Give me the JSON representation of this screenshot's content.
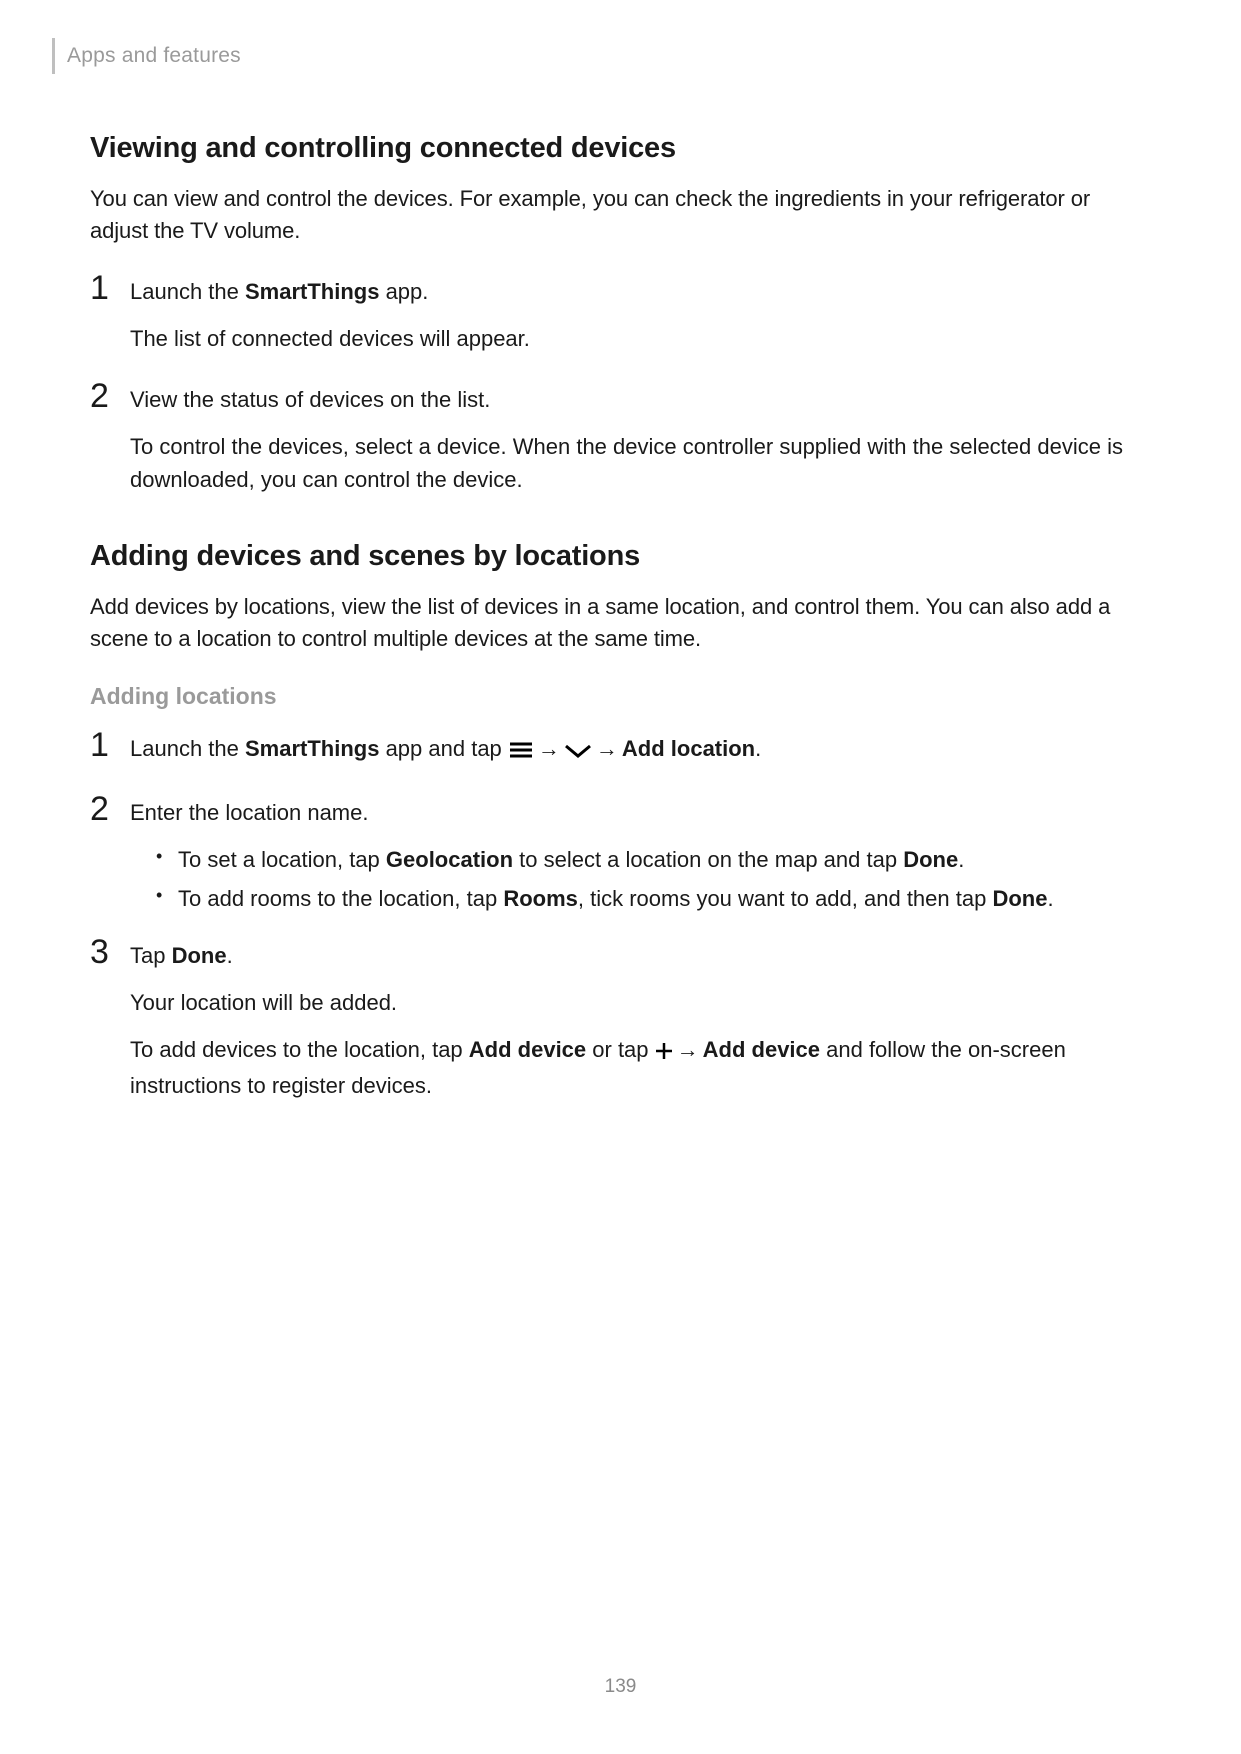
{
  "header": {
    "breadcrumb": "Apps and features"
  },
  "section1": {
    "title": "Viewing and controlling connected devices",
    "intro": "You can view and control the devices. For example, you can check the ingredients in your refrigerator or adjust the TV volume.",
    "steps": [
      {
        "num": "1",
        "line1_pre": "Launch the ",
        "line1_bold": "SmartThings",
        "line1_post": " app.",
        "line2": "The list of connected devices will appear."
      },
      {
        "num": "2",
        "line1": "View the status of devices on the list.",
        "line2": "To control the devices, select a device. When the device controller supplied with the selected device is downloaded, you can control the device."
      }
    ]
  },
  "section2": {
    "title": "Adding devices and scenes by locations",
    "intro": "Add devices by locations, view the list of devices in a same location, and control them. You can also add a scene to a location to control multiple devices at the same time.",
    "subheading": "Adding locations",
    "steps": [
      {
        "num": "1",
        "pre": "Launch the ",
        "bold1": "SmartThings",
        "mid": " app and tap ",
        "arrow1": " → ",
        "arrow2": " → ",
        "bold2": "Add location",
        "post": "."
      },
      {
        "num": "2",
        "line1": "Enter the location name.",
        "bullets": [
          {
            "pre": "To set a location, tap ",
            "b1": "Geolocation",
            "mid": " to select a location on the map and tap ",
            "b2": "Done",
            "post": "."
          },
          {
            "pre": "To add rooms to the location, tap ",
            "b1": "Rooms",
            "mid": ", tick rooms you want to add, and then tap ",
            "b2": "Done",
            "post": "."
          }
        ]
      },
      {
        "num": "3",
        "line1_pre": "Tap ",
        "line1_bold": "Done",
        "line1_post": ".",
        "line2": "Your location will be added.",
        "line3_pre": "To add devices to the location, tap ",
        "line3_b1": "Add device",
        "line3_mid1": " or tap ",
        "line3_arrow": " → ",
        "line3_b2": "Add device",
        "line3_post": " and follow the on-screen instructions to register devices."
      }
    ]
  },
  "pageNumber": "139"
}
